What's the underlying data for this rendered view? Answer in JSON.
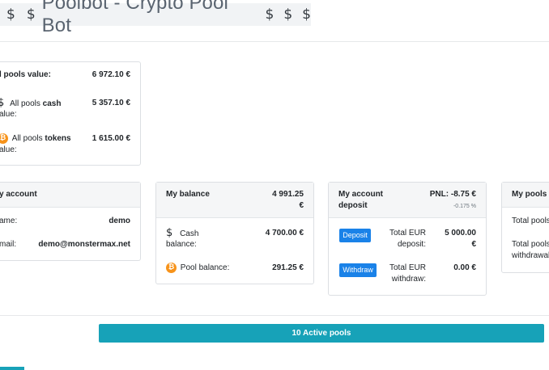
{
  "header": {
    "dollar_symbol": "$",
    "title": "Poolbot - Crypto Pool Bot"
  },
  "pools_card": {
    "all_pools_value_label": "l pools value:",
    "all_pools_value": "6 972.10 €",
    "cash_label_prefix": "All pools",
    "cash_label_bold": "cash",
    "cash_label_line2": "alue:",
    "cash_value": "5 357.10 €",
    "tokens_label_prefix": "All pools",
    "tokens_label_bold": "tokens",
    "tokens_label_line2": "alue:",
    "tokens_value": "1 615.00 €"
  },
  "account_card": {
    "title": "y account",
    "name_label": "ame:",
    "name_value": "demo",
    "email_label": "mail:",
    "email_value": "demo@monstermax.net"
  },
  "balance_card": {
    "title": "My balance",
    "total_line1": "4 991.25",
    "total_line2": "€",
    "cash_label_line1": "Cash",
    "cash_label_line2": "balance:",
    "cash_value": "4 700.00 €",
    "pool_label": "Pool balance:",
    "pool_value": "291.25 €"
  },
  "deposit_card": {
    "title_line1": "My account",
    "title_line2": "deposit",
    "pnl": "PNL: -8.75 €",
    "pnl_pct": "-0.175 %",
    "deposit_button": "Deposit",
    "total_deposit_label_line1": "Total EUR",
    "total_deposit_label_line2": "deposit:",
    "total_deposit_value_line1": "5 000.00",
    "total_deposit_value_line2": "€",
    "withdraw_button": "Withdraw",
    "total_withdraw_label_line1": "Total EUR",
    "total_withdraw_label_line2": "withdraw:",
    "total_withdraw_value": "0.00 €"
  },
  "pools_deposit_card": {
    "title": "My pools d",
    "deposit_label": "Total pools",
    "withdraw_label_line1": "Total pools",
    "withdraw_label_line2": "withdrawal"
  },
  "active_pools_label": "10 Active pools",
  "colors": {
    "accent_teal": "#17a2b8",
    "button_blue": "#1a82e8",
    "bitcoin_orange": "#f7931a"
  },
  "icons": {
    "coin": "bitcoin-icon",
    "cash": "dollar-icon"
  }
}
